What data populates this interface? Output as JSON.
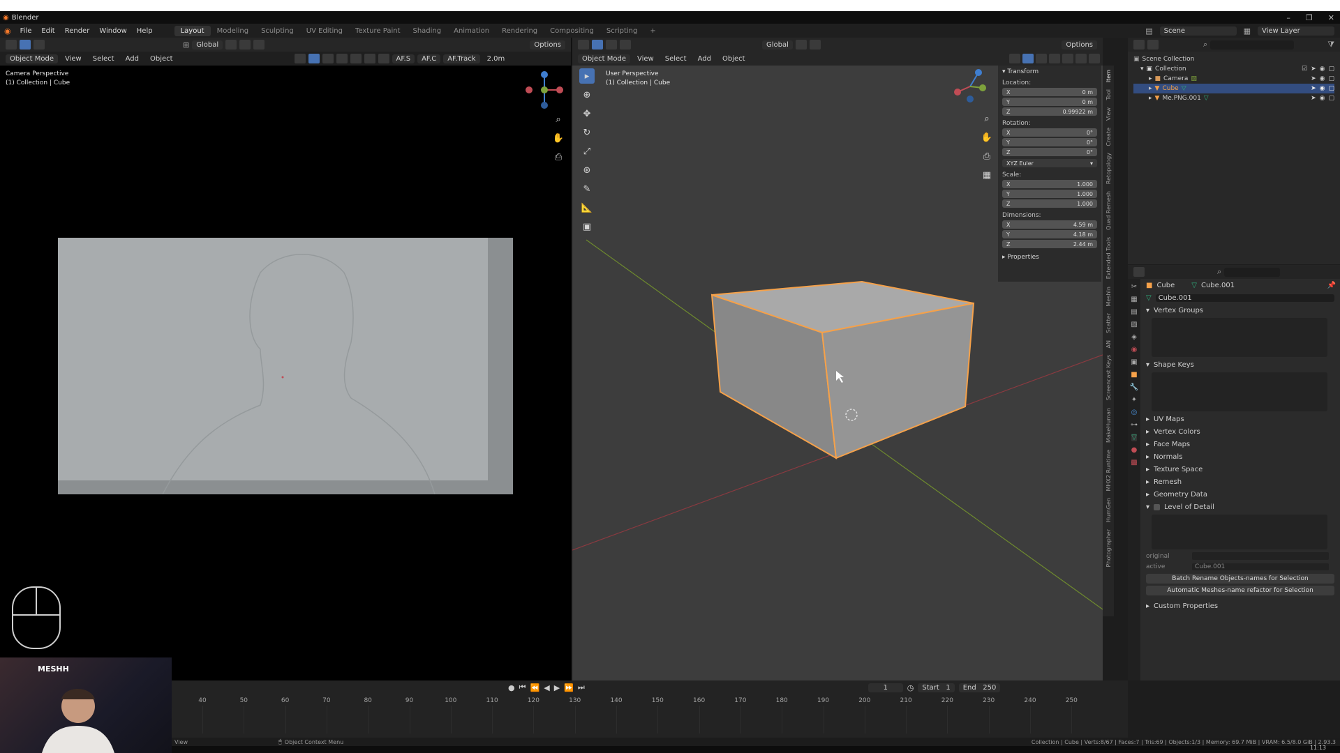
{
  "app": {
    "title": "Blender"
  },
  "window_controls": [
    "–",
    "❐",
    "✕"
  ],
  "menu": {
    "items": [
      "File",
      "Edit",
      "Render",
      "Window",
      "Help"
    ]
  },
  "workspaces": [
    {
      "label": "Layout",
      "active": true
    },
    {
      "label": "Modeling"
    },
    {
      "label": "Sculpting"
    },
    {
      "label": "UV Editing"
    },
    {
      "label": "Texture Paint"
    },
    {
      "label": "Shading"
    },
    {
      "label": "Animation"
    },
    {
      "label": "Rendering"
    },
    {
      "label": "Compositing"
    },
    {
      "label": "Scripting"
    },
    {
      "label": "+"
    }
  ],
  "top_right": {
    "scene": "Scene",
    "view_layer": "View Layer"
  },
  "left_vp": {
    "mode": "Object Mode",
    "menus": [
      "View",
      "Select",
      "Add",
      "Object"
    ],
    "orientation": "Global",
    "options": "Options",
    "af_labels": [
      "AF.S",
      "AF.C",
      "AF.Track",
      "2.0m"
    ],
    "overlay_title": "Camera Perspective",
    "overlay_sub": "(1) Collection | Cube"
  },
  "right_vp": {
    "mode": "Object Mode",
    "menus": [
      "View",
      "Select",
      "Add",
      "Object"
    ],
    "orientation": "Global",
    "options": "Options",
    "overlay_title": "User Perspective",
    "overlay_sub": "(1) Collection | Cube"
  },
  "n_panel": {
    "header": "Transform",
    "location_label": "Location:",
    "location": [
      {
        "axis": "X",
        "value": "0 m"
      },
      {
        "axis": "Y",
        "value": "0 m"
      },
      {
        "axis": "Z",
        "value": "0.99922 m"
      }
    ],
    "rotation_label": "Rotation:",
    "rotation": [
      {
        "axis": "X",
        "value": "0°"
      },
      {
        "axis": "Y",
        "value": "0°"
      },
      {
        "axis": "Z",
        "value": "0°"
      }
    ],
    "rotation_mode": "XYZ Euler",
    "scale_label": "Scale:",
    "scale": [
      {
        "axis": "X",
        "value": "1.000"
      },
      {
        "axis": "Y",
        "value": "1.000"
      },
      {
        "axis": "Z",
        "value": "1.000"
      }
    ],
    "dimensions_label": "Dimensions:",
    "dimensions": [
      {
        "axis": "X",
        "value": "4.59 m"
      },
      {
        "axis": "Y",
        "value": "4.18 m"
      },
      {
        "axis": "Z",
        "value": "2.44 m"
      }
    ],
    "properties_label": "Properties"
  },
  "side_tabs": [
    "Item",
    "Tool",
    "View",
    "Create",
    "Retopology",
    "Quad Remesh",
    "Extended Tools",
    "MeshIn",
    "Scatter",
    "AN",
    "Screencast Keys",
    "MakeHuman",
    "MHX2 Runtime",
    "HumGen",
    "Photographer"
  ],
  "outliner": {
    "root": "Scene Collection",
    "collection": "Collection",
    "items": [
      {
        "label": "Camera",
        "selected": false
      },
      {
        "label": "Cube",
        "selected": true
      },
      {
        "label": "Me.PNG.001",
        "selected": false
      }
    ]
  },
  "properties": {
    "object_name": "Cube",
    "mesh_name": "Cube.001",
    "datablock": "Cube.001",
    "sections": {
      "vertex_groups": "Vertex Groups",
      "shape_keys": "Shape Keys",
      "uv_maps": "UV Maps",
      "vertex_colors": "Vertex Colors",
      "face_maps": "Face Maps",
      "normals": "Normals",
      "texture_space": "Texture Space",
      "remesh": "Remesh",
      "geometry_data": "Geometry Data",
      "level_of_detail": "Level of Detail",
      "custom_properties": "Custom Properties"
    },
    "lod": {
      "original_label": "original",
      "active_label": "active",
      "active_value": "Cube.001"
    },
    "buttons": {
      "batch_rename": "Batch Rename Objects-names for Selection",
      "auto_meshes": "Automatic Meshes-name refactor for Selection"
    }
  },
  "timeline": {
    "current_frame": "1",
    "start_label": "Start",
    "start": "1",
    "end_label": "End",
    "end": "250",
    "ticks": [
      "40",
      "50",
      "60",
      "70",
      "80",
      "90",
      "100",
      "110",
      "120",
      "130",
      "140",
      "150",
      "160",
      "170",
      "180",
      "190",
      "200",
      "210",
      "220",
      "230",
      "240",
      "250"
    ]
  },
  "status": {
    "left": "View",
    "middle": "Object Context Menu",
    "right": "Collection | Cube | Verts:8/67 | Faces:7 | Tris:69 | Objects:1/3 | Memory: 69.7 MiB | VRAM: 6.5/8.0 GiB | 2.93.3"
  },
  "webcam": {
    "logo": "MESHH"
  },
  "clock": "11:13",
  "colors": {
    "accent": "#4772b3",
    "selection": "#f5a14a",
    "x_axis": "#c04c55",
    "y_axis": "#7ea23c",
    "z_axis": "#3f7ed0"
  }
}
